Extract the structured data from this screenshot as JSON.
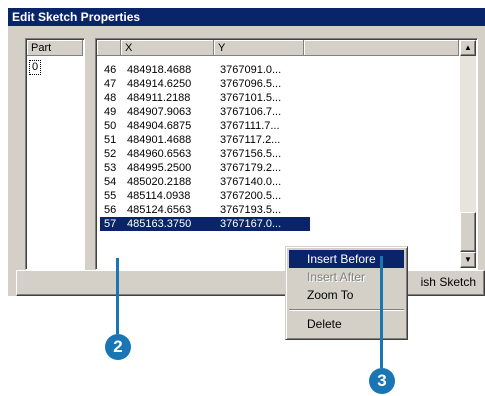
{
  "window": {
    "title": "Edit Sketch Properties"
  },
  "parts": {
    "header": "Part",
    "items": [
      "0"
    ]
  },
  "grid": {
    "columns": [
      "",
      "X",
      "Y"
    ],
    "rows": [
      [
        "46",
        "484918.4688",
        "3767091.0..."
      ],
      [
        "47",
        "484914.6250",
        "3767096.5..."
      ],
      [
        "48",
        "484911.2188",
        "3767101.5..."
      ],
      [
        "49",
        "484907.9063",
        "3767106.7..."
      ],
      [
        "50",
        "484904.6875",
        "3767111.7..."
      ],
      [
        "51",
        "484901.4688",
        "3767117.2..."
      ],
      [
        "52",
        "484960.6563",
        "3767156.5..."
      ],
      [
        "53",
        "484995.2500",
        "3767179.2..."
      ],
      [
        "54",
        "485020.2188",
        "3767140.0..."
      ],
      [
        "55",
        "485114.0938",
        "3767200.5..."
      ],
      [
        "56",
        "485124.6563",
        "3767193.5..."
      ],
      [
        "57",
        "485163.3750",
        "3767167.0..."
      ]
    ],
    "selected_row": "57"
  },
  "buttons": {
    "finish_partial": "ish Sketch"
  },
  "context_menu": {
    "items": [
      "Insert Before",
      "Insert After",
      "Zoom To",
      "Delete"
    ],
    "highlighted": "Insert Before",
    "disabled": [
      "Insert After"
    ]
  },
  "callouts": [
    "2",
    "3"
  ],
  "colors": {
    "selection": "#0a246a",
    "callout": "#1a75b5",
    "dialog_face": "#d4d0c8"
  }
}
